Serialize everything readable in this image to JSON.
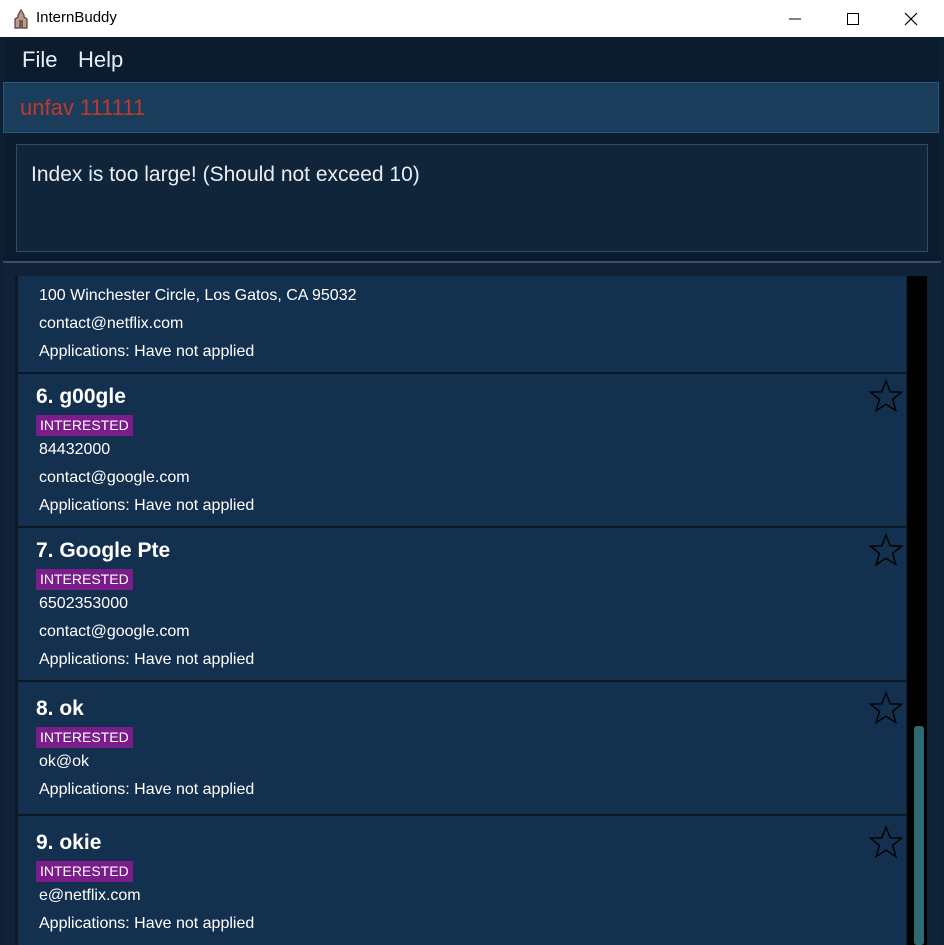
{
  "window": {
    "title": "InternBuddy"
  },
  "menu": [
    {
      "label": "File"
    },
    {
      "label": "Help"
    }
  ],
  "command_box": {
    "value": "unfav 111111"
  },
  "result": {
    "message": "Index is too large! (Should not exceed 10)"
  },
  "cards": [
    {
      "title": "",
      "tag": "",
      "phone": "",
      "address": "100 Winchester Circle, Los Gatos, CA 95032",
      "email": "contact@netflix.com",
      "applications": "Applications: Have not applied"
    },
    {
      "title": "6. g00gle",
      "tag": "INTERESTED",
      "phone": "84432000",
      "email": "contact@google.com",
      "applications": "Applications: Have not applied"
    },
    {
      "title": "7. Google Pte",
      "tag": "INTERESTED",
      "phone": "6502353000",
      "email": "contact@google.com",
      "applications": "Applications: Have not applied"
    },
    {
      "title": "8. ok",
      "tag": "INTERESTED",
      "email": "ok@ok",
      "applications": "Applications: Have not applied"
    },
    {
      "title": "9. okie",
      "tag": "INTERESTED",
      "email": "e@netflix.com",
      "applications": "Applications: Have not applied"
    }
  ],
  "colors": {
    "tag_bg": "#7a1c8a",
    "command_text": "#c0392b",
    "card_bg": "#14304f"
  },
  "icons": {
    "favorite": "star-outline-icon"
  }
}
